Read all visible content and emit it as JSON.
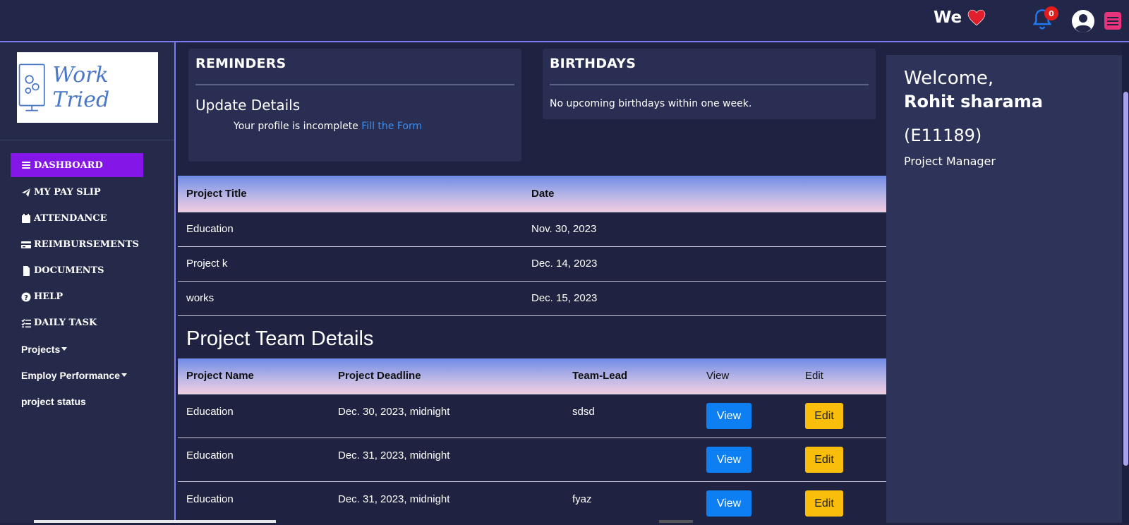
{
  "header": {
    "we_text": "We",
    "notification_count": "0"
  },
  "sidebar": {
    "logo_text": "Work Tried",
    "items": [
      {
        "label": "DASHBOARD",
        "icon": "bars-icon"
      },
      {
        "label": "MY PAY SLIP",
        "icon": "paper-plane-icon"
      },
      {
        "label": "ATTENDANCE",
        "icon": "calendar-icon"
      },
      {
        "label": "REIMBURSEMENTS",
        "icon": "credit-card-icon"
      },
      {
        "label": "DOCUMENTS",
        "icon": "file-icon"
      },
      {
        "label": "HELP",
        "icon": "question-circle-icon"
      },
      {
        "label": "DAILY TASK",
        "icon": "tasks-icon"
      },
      {
        "label": "Projects"
      },
      {
        "label": "Employ Performance"
      },
      {
        "label": "project status"
      }
    ]
  },
  "reminders": {
    "title": "REMINDERS",
    "subtitle": "Update Details",
    "message": "Your profile is incomplete",
    "link": "Fill the Form"
  },
  "birthdays": {
    "title": "BIRTHDAYS",
    "message": "No upcoming birthdays within one week."
  },
  "projects_table": {
    "headers": [
      "Project Title",
      "Date"
    ],
    "rows": [
      [
        "Education",
        "Nov. 30, 2023"
      ],
      [
        "Project k",
        "Dec. 14, 2023"
      ],
      [
        "works",
        "Dec. 15, 2023"
      ]
    ]
  },
  "team_section": {
    "title": "Project Team Details",
    "headers": [
      "Project Name",
      "Project Deadline",
      "Team-Lead",
      "View",
      "Edit"
    ],
    "view_label": "View",
    "edit_label": "Edit",
    "rows": [
      [
        "Education",
        "Dec. 30, 2023, midnight",
        "sdsd"
      ],
      [
        "Education",
        "Dec. 31, 2023, midnight",
        ""
      ],
      [
        "Education",
        "Dec. 31, 2023, midnight",
        "fyaz"
      ]
    ]
  },
  "profile": {
    "welcome": "Welcome,",
    "name": "Rohit sharama",
    "employee_id": "(E11189)",
    "role": "Project Manager"
  },
  "colors": {
    "accent": "#8417e8",
    "view_button": "#0d7ff2",
    "edit_button": "#f8be0b",
    "link": "#3c8ff0"
  }
}
